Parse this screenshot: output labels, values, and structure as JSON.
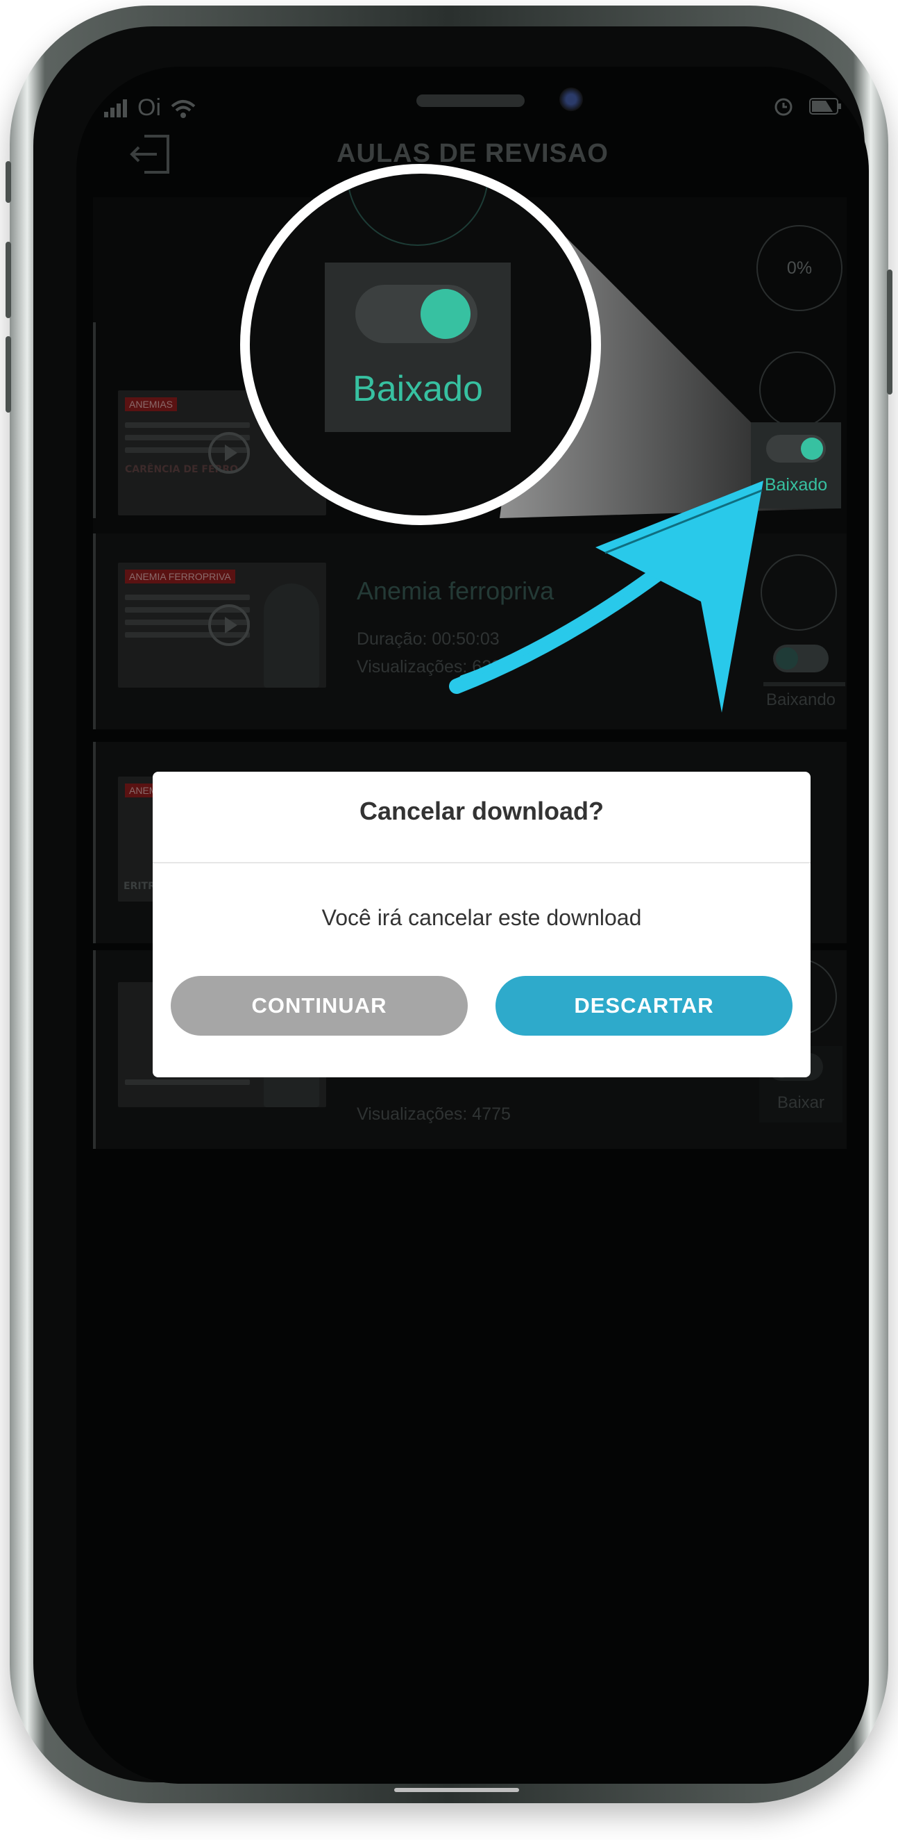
{
  "status_bar": {
    "carrier": "Oi"
  },
  "header": {
    "title": "AULAS DE REVISAO"
  },
  "lessons": [
    {
      "title": "",
      "duration": "",
      "views": "",
      "thumb_tag": "ANEMIAS",
      "thumb_subtitle": "CARÊNCIA DE FERRO",
      "progress": "0%"
    },
    {
      "title": "Anemia ferropriva",
      "duration": "Duração: 00:50:03",
      "views": "Visualizações: 6233",
      "thumb_tag": "ANEMIA FERROPRIVA",
      "status": "Baixando"
    },
    {
      "title": "",
      "duration": "",
      "views": "",
      "thumb_tag": "ANEMIAS",
      "thumb_subtitle": "ERITROP"
    },
    {
      "title": "",
      "duration": "",
      "views": "Visualizações: 4775",
      "status": "Baixar"
    }
  ],
  "highlight": {
    "label": "Baixado",
    "magnified_label": "Baixado"
  },
  "dialog": {
    "title": "Cancelar download?",
    "message": "Você irá cancelar este download",
    "continue_label": "CONTINUAR",
    "discard_label": "DESCARTAR"
  },
  "colors": {
    "accent": "#37c1a1",
    "arrow": "#29c9ea",
    "discard_button": "#2eaacb",
    "continue_button": "#a6a6a6"
  }
}
